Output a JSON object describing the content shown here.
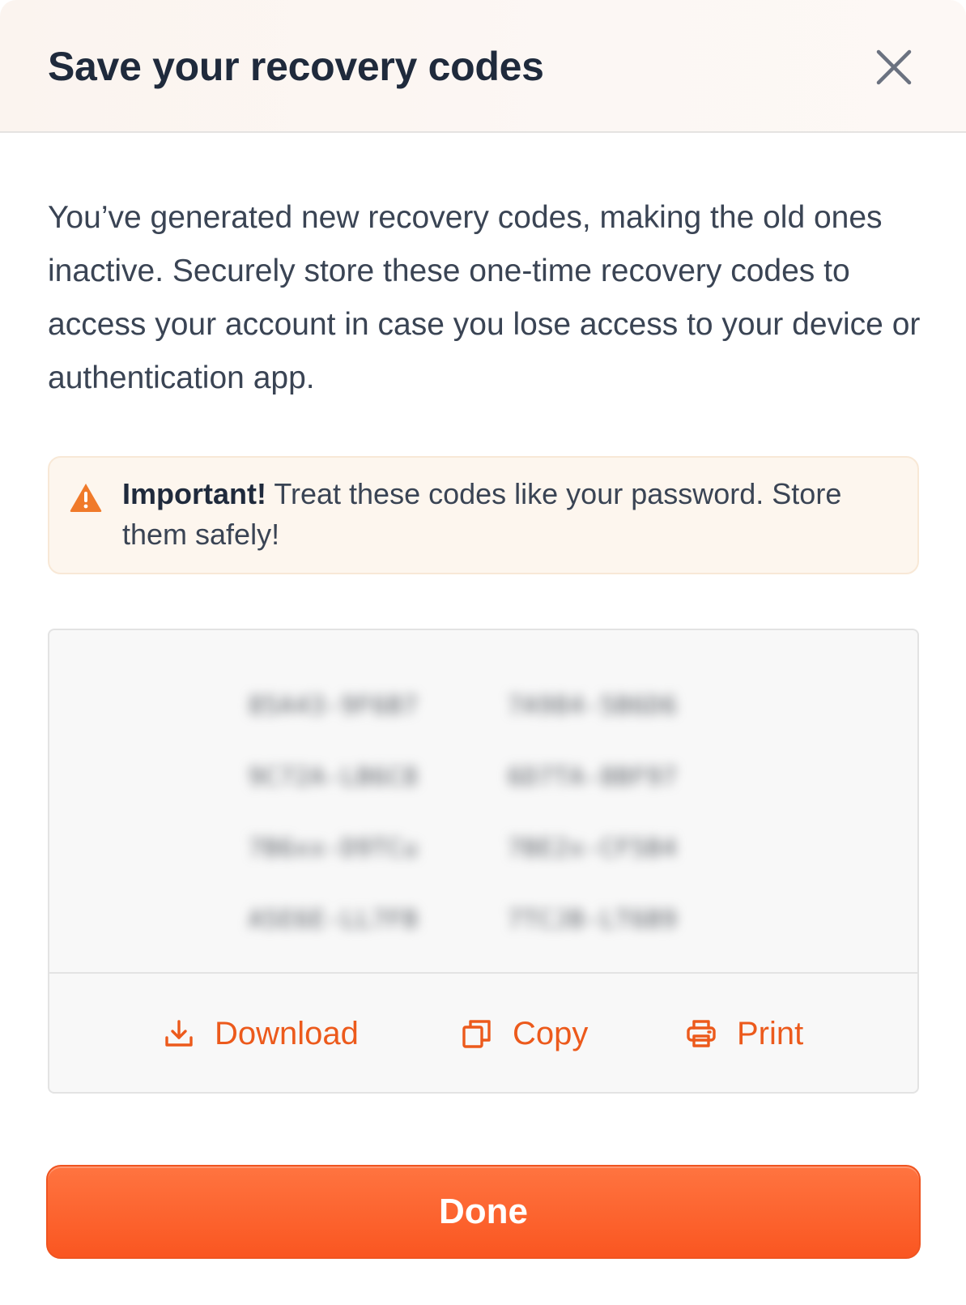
{
  "modal": {
    "title": "Save your recovery codes",
    "close_icon": "close-icon",
    "description": "You’ve generated new recovery codes, making the old ones inactive. Securely store these one-time recovery codes to access your account in case you lose access to your device or authentication app."
  },
  "alert": {
    "icon": "warning-triangle-icon",
    "strong": "Important!",
    "text": " Treat these codes like your password. Store them safely!",
    "color": "#f07a2a"
  },
  "codes": [
    "85A43-9F6B7",
    "7A984-5B6D6",
    "9C72A-LB6C8",
    "6D7TA-8BF97",
    "7B6xx-D9TCu",
    "7BE2x-CF5B4",
    "A5E6E-LL7FB",
    "7TCJB-LT6B9"
  ],
  "actions": {
    "download_label": "Download",
    "copy_label": "Copy",
    "print_label": "Print"
  },
  "done_label": "Done",
  "colors": {
    "accent": "#ec5a1c",
    "button": "#fa5621",
    "title": "#1f2a3c",
    "alert_bg": "#fdf6ee"
  }
}
